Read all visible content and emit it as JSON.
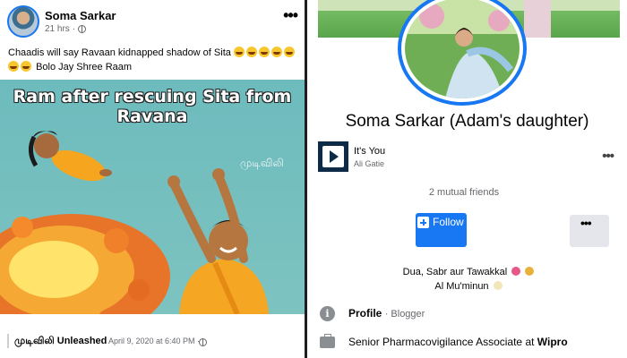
{
  "post": {
    "author": "Soma Sarkar",
    "time": "21 hrs",
    "caption_line1": "Chaadis will say Ravaan kidnapped shadow of Sita",
    "caption_line2": "Bolo Jay Shree Raam",
    "meme_title": "Ram after rescuing Sita from Ravana",
    "meme_watermark": "முடிவிலி",
    "shared_page_name": "முடிவிலி Unleashed",
    "shared_page_date": "April 9, 2020 at 6:40 PM ·",
    "more_icon": "more-horizontal-icon",
    "privacy_icon": "globe-icon"
  },
  "profile": {
    "name": "Soma Sarkar (Adam's daughter)",
    "music": {
      "song": "It's You",
      "artist": "Ali Gatie"
    },
    "mutual_friends": "2 mutual friends",
    "follow_label": "Follow",
    "bio_line1": "Dua, Sabr aur Tawakkal",
    "bio_line2": "Al Mu'minun",
    "profile_label": "Profile",
    "profile_value": "· Blogger",
    "job_title": "Senior Pharmacovigilance Associate at",
    "job_company": "Wipro"
  },
  "colors": {
    "accent": "#1877f2",
    "meme_bg": "#6dbbbd"
  }
}
